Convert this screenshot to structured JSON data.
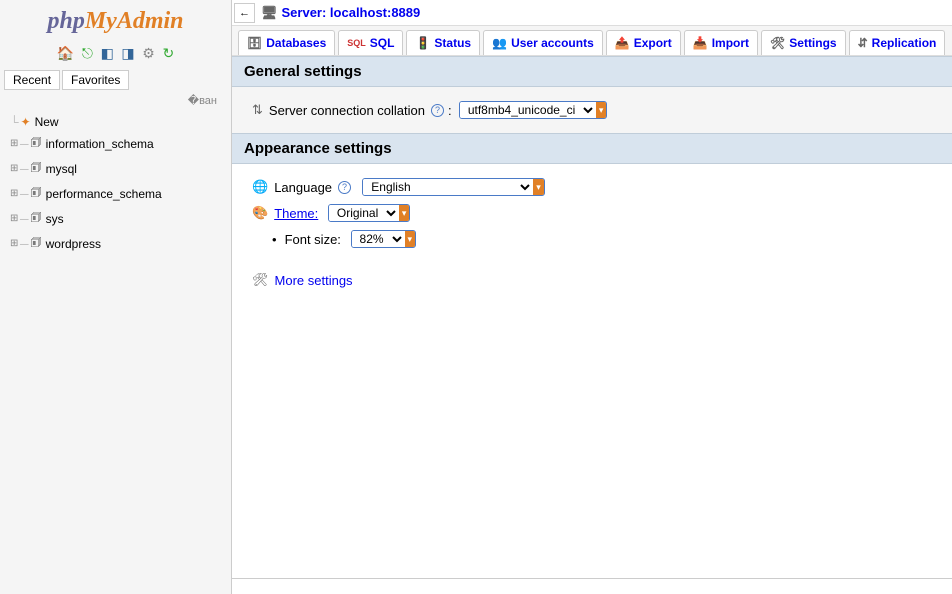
{
  "logo": {
    "php": "php",
    "my": "My",
    "admin": "Admin"
  },
  "sidebar_tabs": {
    "recent": "Recent",
    "favorites": "Favorites"
  },
  "tree": {
    "new": "New",
    "items": [
      "information_schema",
      "mysql",
      "performance_schema",
      "sys",
      "wordpress"
    ]
  },
  "server": {
    "label": "Server: localhost:8889"
  },
  "nav": [
    {
      "label": "Databases"
    },
    {
      "label": "SQL"
    },
    {
      "label": "Status"
    },
    {
      "label": "User accounts"
    },
    {
      "label": "Export"
    },
    {
      "label": "Import"
    },
    {
      "label": "Settings"
    },
    {
      "label": "Replication"
    }
  ],
  "sections": {
    "general": {
      "title": "General settings",
      "collation_label": "Server connection collation",
      "collation_value": "utf8mb4_unicode_ci"
    },
    "appearance": {
      "title": "Appearance settings",
      "language_label": "Language",
      "language_value": "English",
      "theme_label": "Theme:",
      "theme_value": "Original",
      "fontsize_label": "Font size:",
      "fontsize_value": "82%"
    },
    "more": "More settings"
  }
}
